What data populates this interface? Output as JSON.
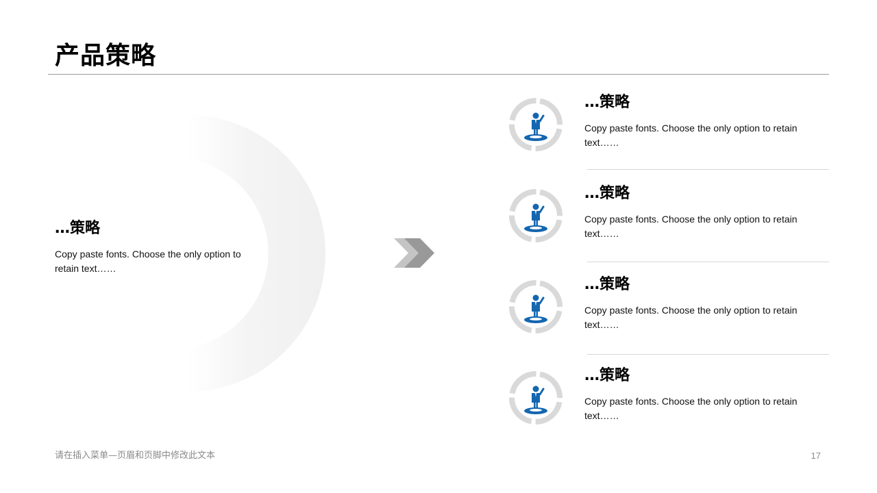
{
  "slide": {
    "title": "产品策略"
  },
  "left_panel": {
    "heading": "…策略",
    "text": "Copy paste fonts. Choose the only option to retain text……"
  },
  "items": [
    {
      "heading": "…策略",
      "text": "Copy paste fonts. Choose the only option to retain text……",
      "icon": "person-on-platform-icon"
    },
    {
      "heading": "…策略",
      "text": "Copy paste fonts. Choose the only option to retain text……",
      "icon": "person-on-platform-icon"
    },
    {
      "heading": "…策略",
      "text": "Copy paste fonts. Choose the only option to retain text……",
      "icon": "person-on-platform-icon"
    },
    {
      "heading": "…策略",
      "text": "Copy paste fonts. Choose the only option to retain text……",
      "icon": "person-on-platform-icon"
    }
  ],
  "decorations": {
    "arrow_icon": "double-chevron-right-icon",
    "accent_color": "#1466b0",
    "ring_color": "#d9d9d9",
    "arrow_colors": [
      "#999999",
      "#c4c4c4"
    ]
  },
  "footer": {
    "text": "请在插入菜单—页眉和页脚中修改此文本",
    "page_number": "17"
  }
}
